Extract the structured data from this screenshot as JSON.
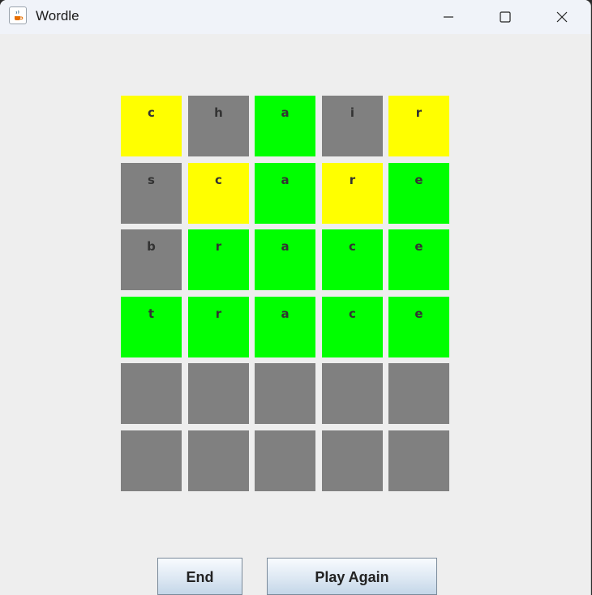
{
  "window": {
    "title": "Wordle",
    "icon": "java-cup-icon"
  },
  "colors": {
    "green": "#00ff00",
    "yellow": "#ffff00",
    "gray": "#808080",
    "background": "#eeeeee"
  },
  "board": {
    "rows": [
      [
        {
          "letter": "c",
          "state": "yellow"
        },
        {
          "letter": "h",
          "state": "gray"
        },
        {
          "letter": "a",
          "state": "green"
        },
        {
          "letter": "i",
          "state": "gray"
        },
        {
          "letter": "r",
          "state": "yellow"
        }
      ],
      [
        {
          "letter": "s",
          "state": "gray"
        },
        {
          "letter": "c",
          "state": "yellow"
        },
        {
          "letter": "a",
          "state": "green"
        },
        {
          "letter": "r",
          "state": "yellow"
        },
        {
          "letter": "e",
          "state": "green"
        }
      ],
      [
        {
          "letter": "b",
          "state": "gray"
        },
        {
          "letter": "r",
          "state": "green"
        },
        {
          "letter": "a",
          "state": "green"
        },
        {
          "letter": "c",
          "state": "green"
        },
        {
          "letter": "e",
          "state": "green"
        }
      ],
      [
        {
          "letter": "t",
          "state": "green"
        },
        {
          "letter": "r",
          "state": "green"
        },
        {
          "letter": "a",
          "state": "green"
        },
        {
          "letter": "c",
          "state": "green"
        },
        {
          "letter": "e",
          "state": "green"
        }
      ],
      [
        {
          "letter": "",
          "state": "gray"
        },
        {
          "letter": "",
          "state": "gray"
        },
        {
          "letter": "",
          "state": "gray"
        },
        {
          "letter": "",
          "state": "gray"
        },
        {
          "letter": "",
          "state": "gray"
        }
      ],
      [
        {
          "letter": "",
          "state": "gray"
        },
        {
          "letter": "",
          "state": "gray"
        },
        {
          "letter": "",
          "state": "gray"
        },
        {
          "letter": "",
          "state": "gray"
        },
        {
          "letter": "",
          "state": "gray"
        }
      ]
    ]
  },
  "buttons": {
    "end_label": "End",
    "play_again_label": "Play Again"
  }
}
